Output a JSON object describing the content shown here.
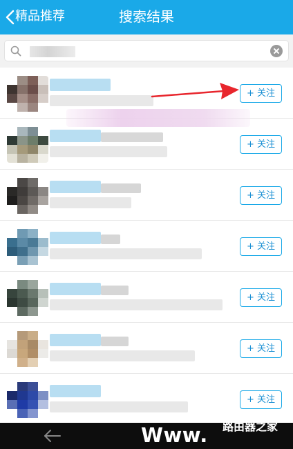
{
  "header": {
    "back_label": "精品推荐",
    "title": "搜索结果"
  },
  "search": {
    "value": "",
    "placeholder": ""
  },
  "results": [
    {
      "follow_label": "+ 关注"
    },
    {
      "follow_label": "+ 关注"
    },
    {
      "follow_label": "+ 关注"
    },
    {
      "follow_label": "+ 关注"
    },
    {
      "follow_label": "+ 关注"
    },
    {
      "follow_label": "+ 关注"
    },
    {
      "follow_label": "+ 关注"
    }
  ],
  "watermark": {
    "text": "Www.",
    "sub": "路由器之家"
  },
  "colors": {
    "header_bg": "#1aa9e8",
    "accent": "#1a8fd3",
    "arrow": "#e8262d"
  },
  "icons": [
    "back-chevron-icon",
    "search-icon",
    "clear-icon",
    "annotation-arrow",
    "nav-back-icon"
  ]
}
